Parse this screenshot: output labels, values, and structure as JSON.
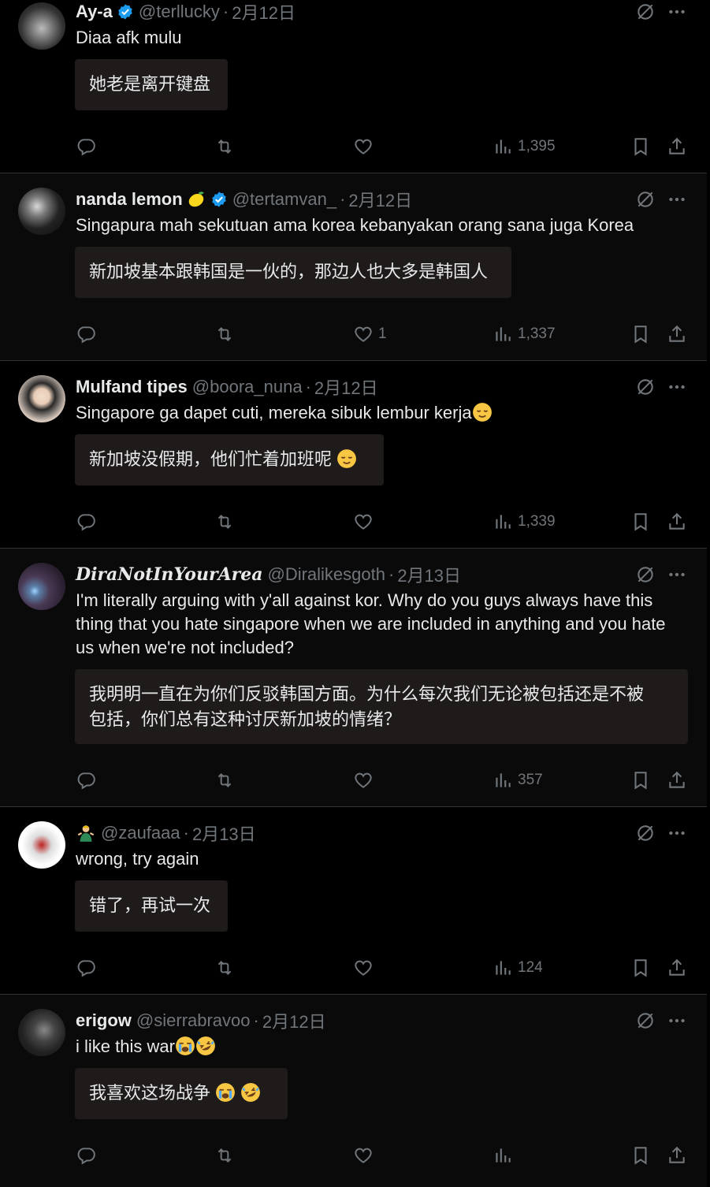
{
  "posts": [
    {
      "name": "Ay-a",
      "verified": true,
      "handle": "@terllucky",
      "date": "2月12日",
      "text": "Diaa afk mulu",
      "translation": "她老是离开键盘",
      "replies": "",
      "reposts": "",
      "likes": "",
      "views": "1,395"
    },
    {
      "name": "nanda lemon",
      "verified": true,
      "handle": "@tertamvan_",
      "date": "2月12日",
      "text": "Singapura mah sekutuan ama korea kebanyakan orang sana juga Korea",
      "translation": "新加坡基本跟韩国是一伙的，那边人也大多是韩国人",
      "replies": "",
      "reposts": "",
      "likes": "1",
      "views": "1,337"
    },
    {
      "name": "Mulfand tipes",
      "verified": false,
      "handle": "@boora_nuna",
      "date": "2月12日",
      "text": "Singapore ga dapet cuti, mereka sibuk lembur kerja",
      "translation": "新加坡没假期，他们忙着加班呢",
      "replies": "",
      "reposts": "",
      "likes": "",
      "views": "1,339"
    },
    {
      "name": "DiraNotInYourArea",
      "verified": false,
      "handle": "@Diralikesgoth",
      "date": "2月13日",
      "text": "I'm literally arguing with y'all against kor. Why do you guys always have this thing that you hate singapore when we are included in anything and you hate us when we're not included?",
      "translation": "我明明一直在为你们反驳韩国方面。为什么每次我们无论被包括还是不被包括，你们总有这种讨厌新加坡的情绪？",
      "replies": "",
      "reposts": "",
      "likes": "",
      "views": "357"
    },
    {
      "name": "",
      "verified": false,
      "handle": "@zaufaaa",
      "date": "2月13日",
      "text": "wrong, try again",
      "translation": "错了，再试一次",
      "replies": "",
      "reposts": "",
      "likes": "",
      "views": "124"
    },
    {
      "name": "erigow",
      "verified": false,
      "handle": "@sierrabravoo",
      "date": "2月12日",
      "text": "i like this war",
      "translation": "我喜欢这场战争",
      "replies": "",
      "reposts": "",
      "likes": "",
      "views": ""
    }
  ],
  "icons": {
    "translate": "translate-icon",
    "more": "more-icon",
    "reply": "reply-icon",
    "repost": "repost-icon",
    "like": "like-icon",
    "views": "views-icon",
    "bookmark": "bookmark-icon",
    "share": "share-icon",
    "verified": "verified-badge-icon"
  },
  "colors": {
    "background": "#000000",
    "text": "#e7e9ea",
    "muted": "#71767b",
    "verified": "#1d9bf0",
    "translation_bg": "#1f1b1b",
    "divider": "#2f3336"
  }
}
